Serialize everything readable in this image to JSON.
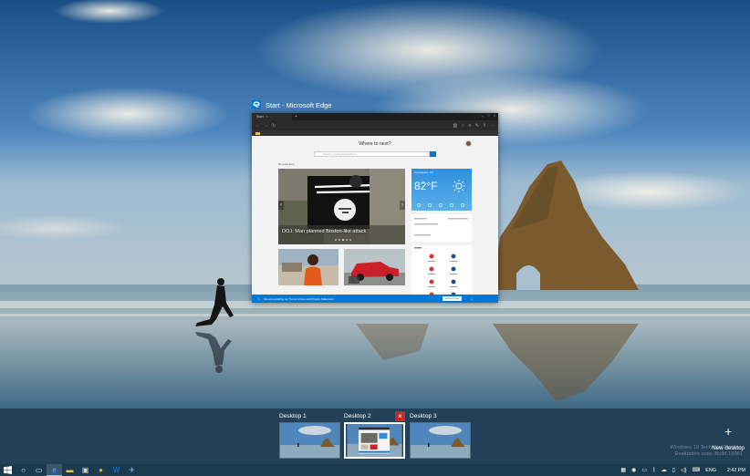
{
  "window": {
    "caption": "Start - Microsoft Edge",
    "tab_title": "Start",
    "heading": "Where to next?",
    "search_placeholder": "Search or enter web address",
    "section_label": "My news feed",
    "hero_caption": "DOJ: Man planned Boston-like attack",
    "weather": {
      "city": "Los Angeles, CA",
      "temp": "82°F"
    },
    "notice": {
      "text": "We are updating our Terms of Use and Privacy Statement",
      "button": "Learn more"
    }
  },
  "desktops": [
    {
      "label": "Desktop 1",
      "active": false
    },
    {
      "label": "Desktop 2",
      "active": true
    },
    {
      "label": "Desktop 3",
      "active": false
    }
  ],
  "new_desktop_label": "New desktop",
  "watermark": {
    "line1": "Windows 10 Technical Preview",
    "line2": "Evaluation copy. Build 10061"
  },
  "taskbar": {
    "apps": [
      "search-icon",
      "task-view-icon",
      "edge-icon",
      "explorer-icon",
      "store-icon",
      "chrome-icon",
      "word-icon",
      "app-icon"
    ],
    "language": "ENG",
    "time": "2:42 PM"
  },
  "colors": {
    "accent": "#0078d7",
    "close": "#c8292d",
    "taskbar": "#1a3a4f"
  }
}
